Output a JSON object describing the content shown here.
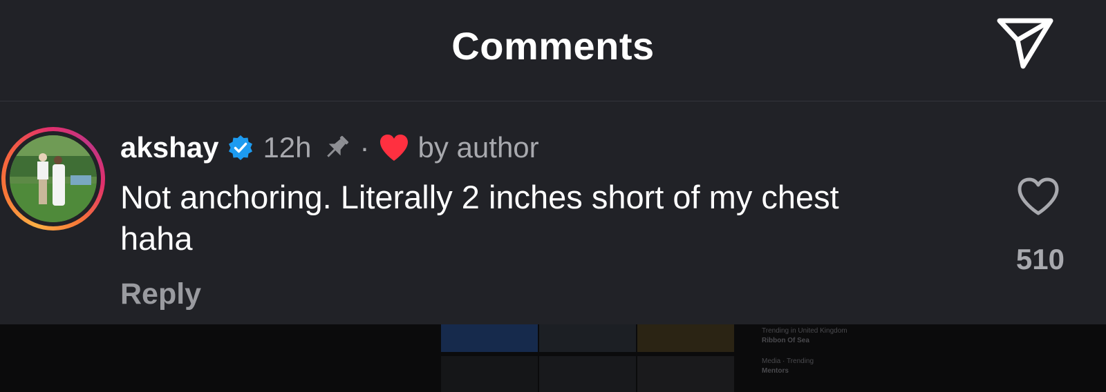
{
  "header": {
    "title": "Comments",
    "send_icon": "send-icon"
  },
  "comment": {
    "username": "akshay",
    "verified_icon": "verified-badge-icon",
    "time": "12h",
    "pin_icon": "pin-icon",
    "separator": "·",
    "liked_by_author_icon": "red-heart-icon",
    "liked_by_author_text": "by author",
    "text": "Not anchoring. Literally 2 inches short of my chest haha",
    "reply_label": "Reply",
    "like_icon": "heart-outline-icon",
    "like_count": "510"
  },
  "background": {
    "items": [
      {
        "label": "Trending in United Kingdom",
        "title": "Ribbon Of Sea"
      },
      {
        "label": "Media · Trending",
        "title": "Mentors"
      }
    ]
  },
  "colors": {
    "background": "#212227",
    "text_primary": "#ffffff",
    "text_secondary": "#a8a9ae",
    "verified": "#1d9bf0",
    "heart_red": "#ff3040"
  }
}
